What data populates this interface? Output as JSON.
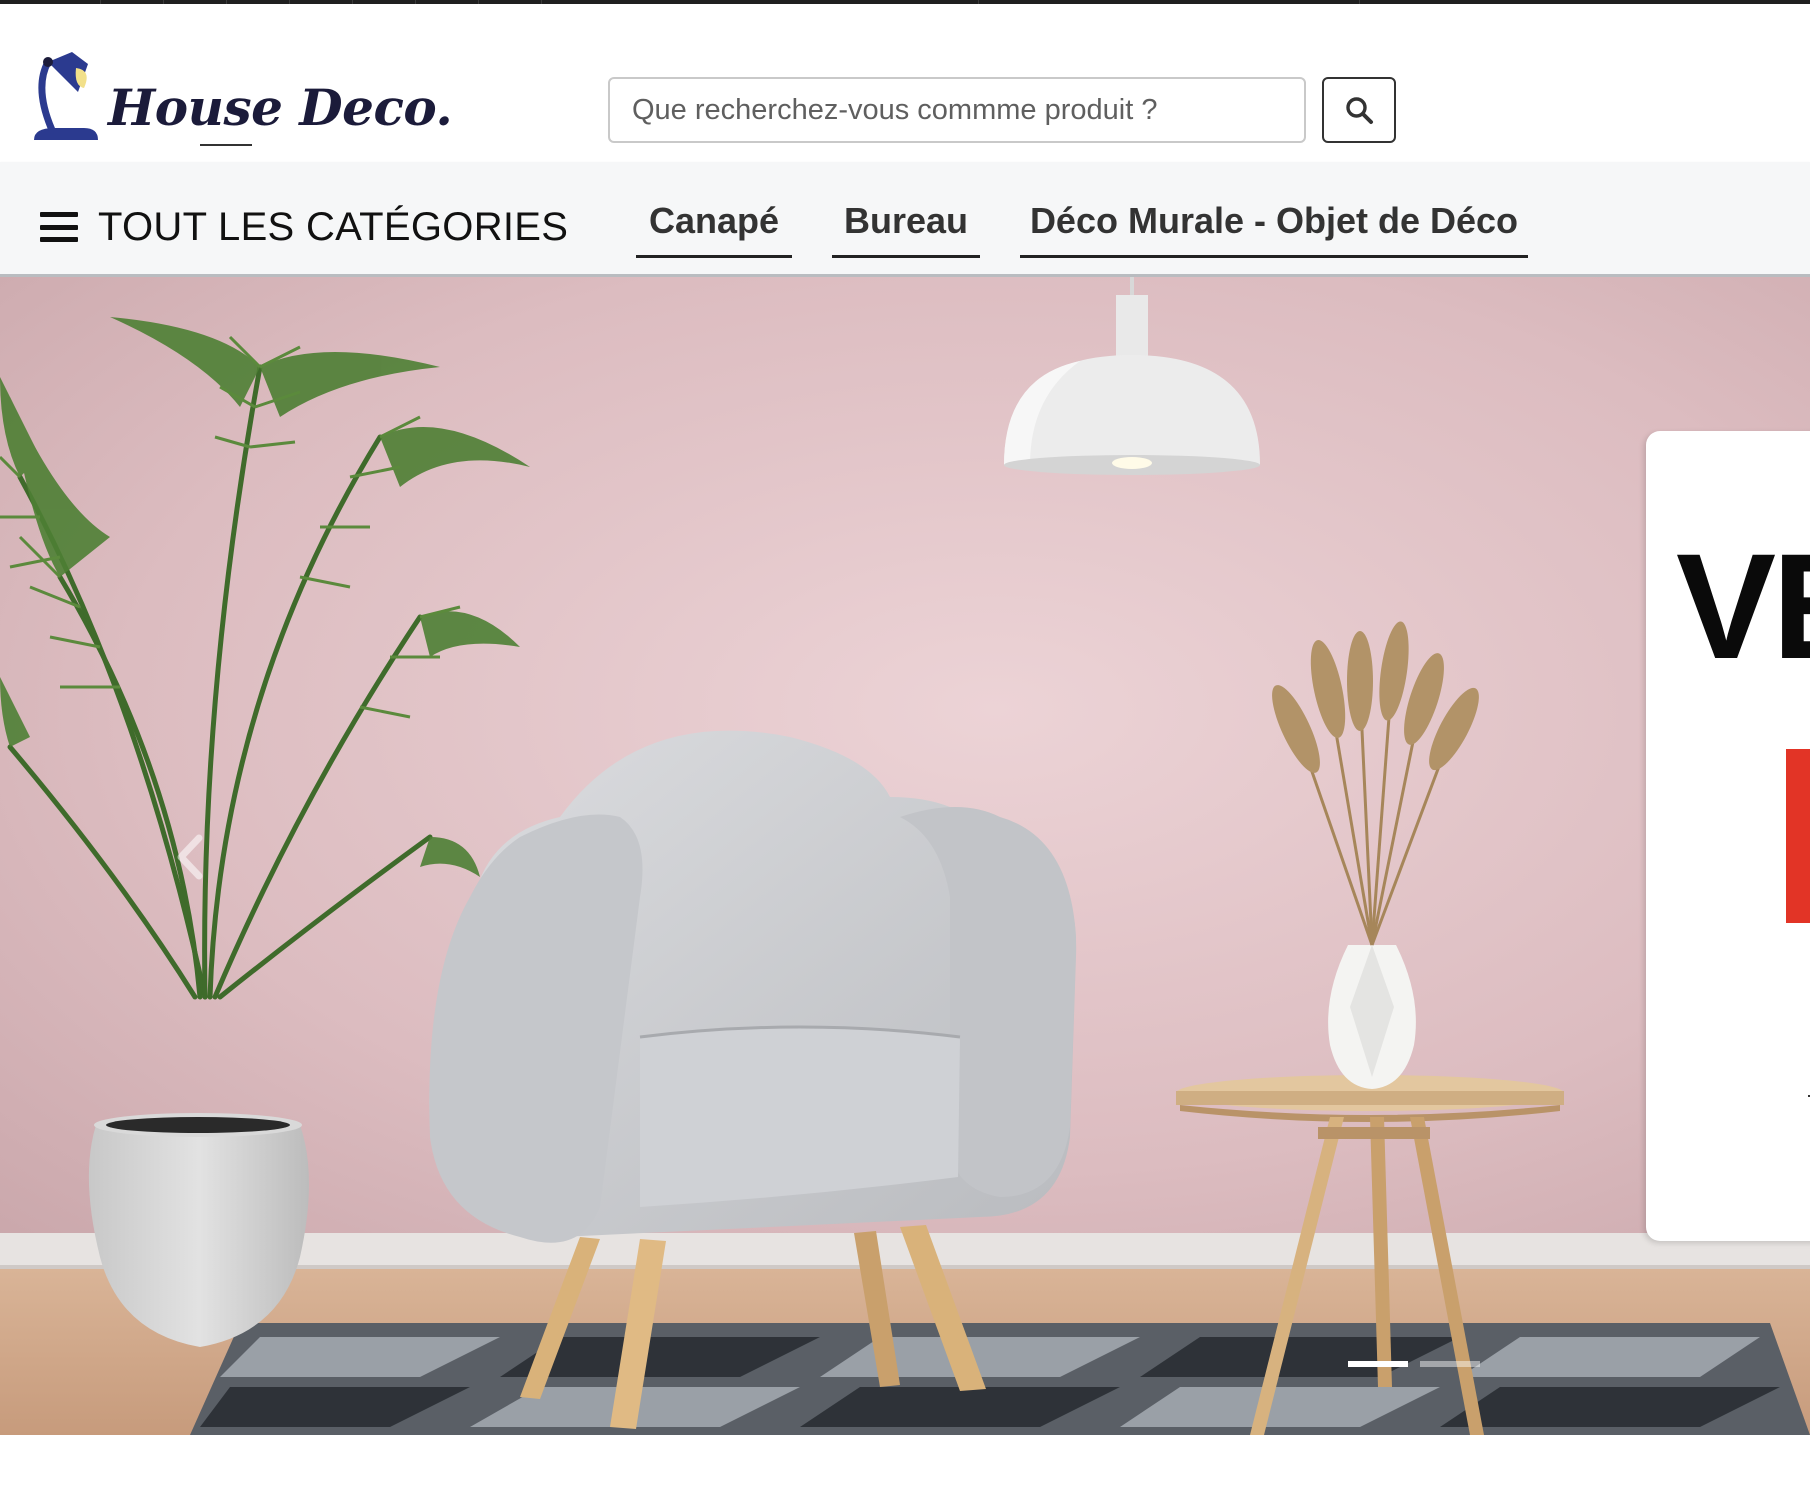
{
  "header": {
    "logo_text": "House Deco.",
    "search_placeholder": "Que recherchez-vous commme produit ?",
    "search_icon": "search-icon"
  },
  "nav": {
    "all_categories_label": "TOUT LES CATÉGORIES",
    "menu_icon": "hamburger-icon",
    "links": [
      {
        "label": "Canapé"
      },
      {
        "label": "Bureau"
      },
      {
        "label": "Déco Murale - Objet de Déco"
      }
    ]
  },
  "hero": {
    "prev_icon": "chevron-left-icon",
    "promo_text": "VE",
    "slide_count": 2,
    "active_slide": 1
  },
  "colors": {
    "wall": "#dcbcc0",
    "nav_bg": "#f6f7f8",
    "promo_red": "#e23426",
    "brand_dark": "#1b1b3a"
  }
}
